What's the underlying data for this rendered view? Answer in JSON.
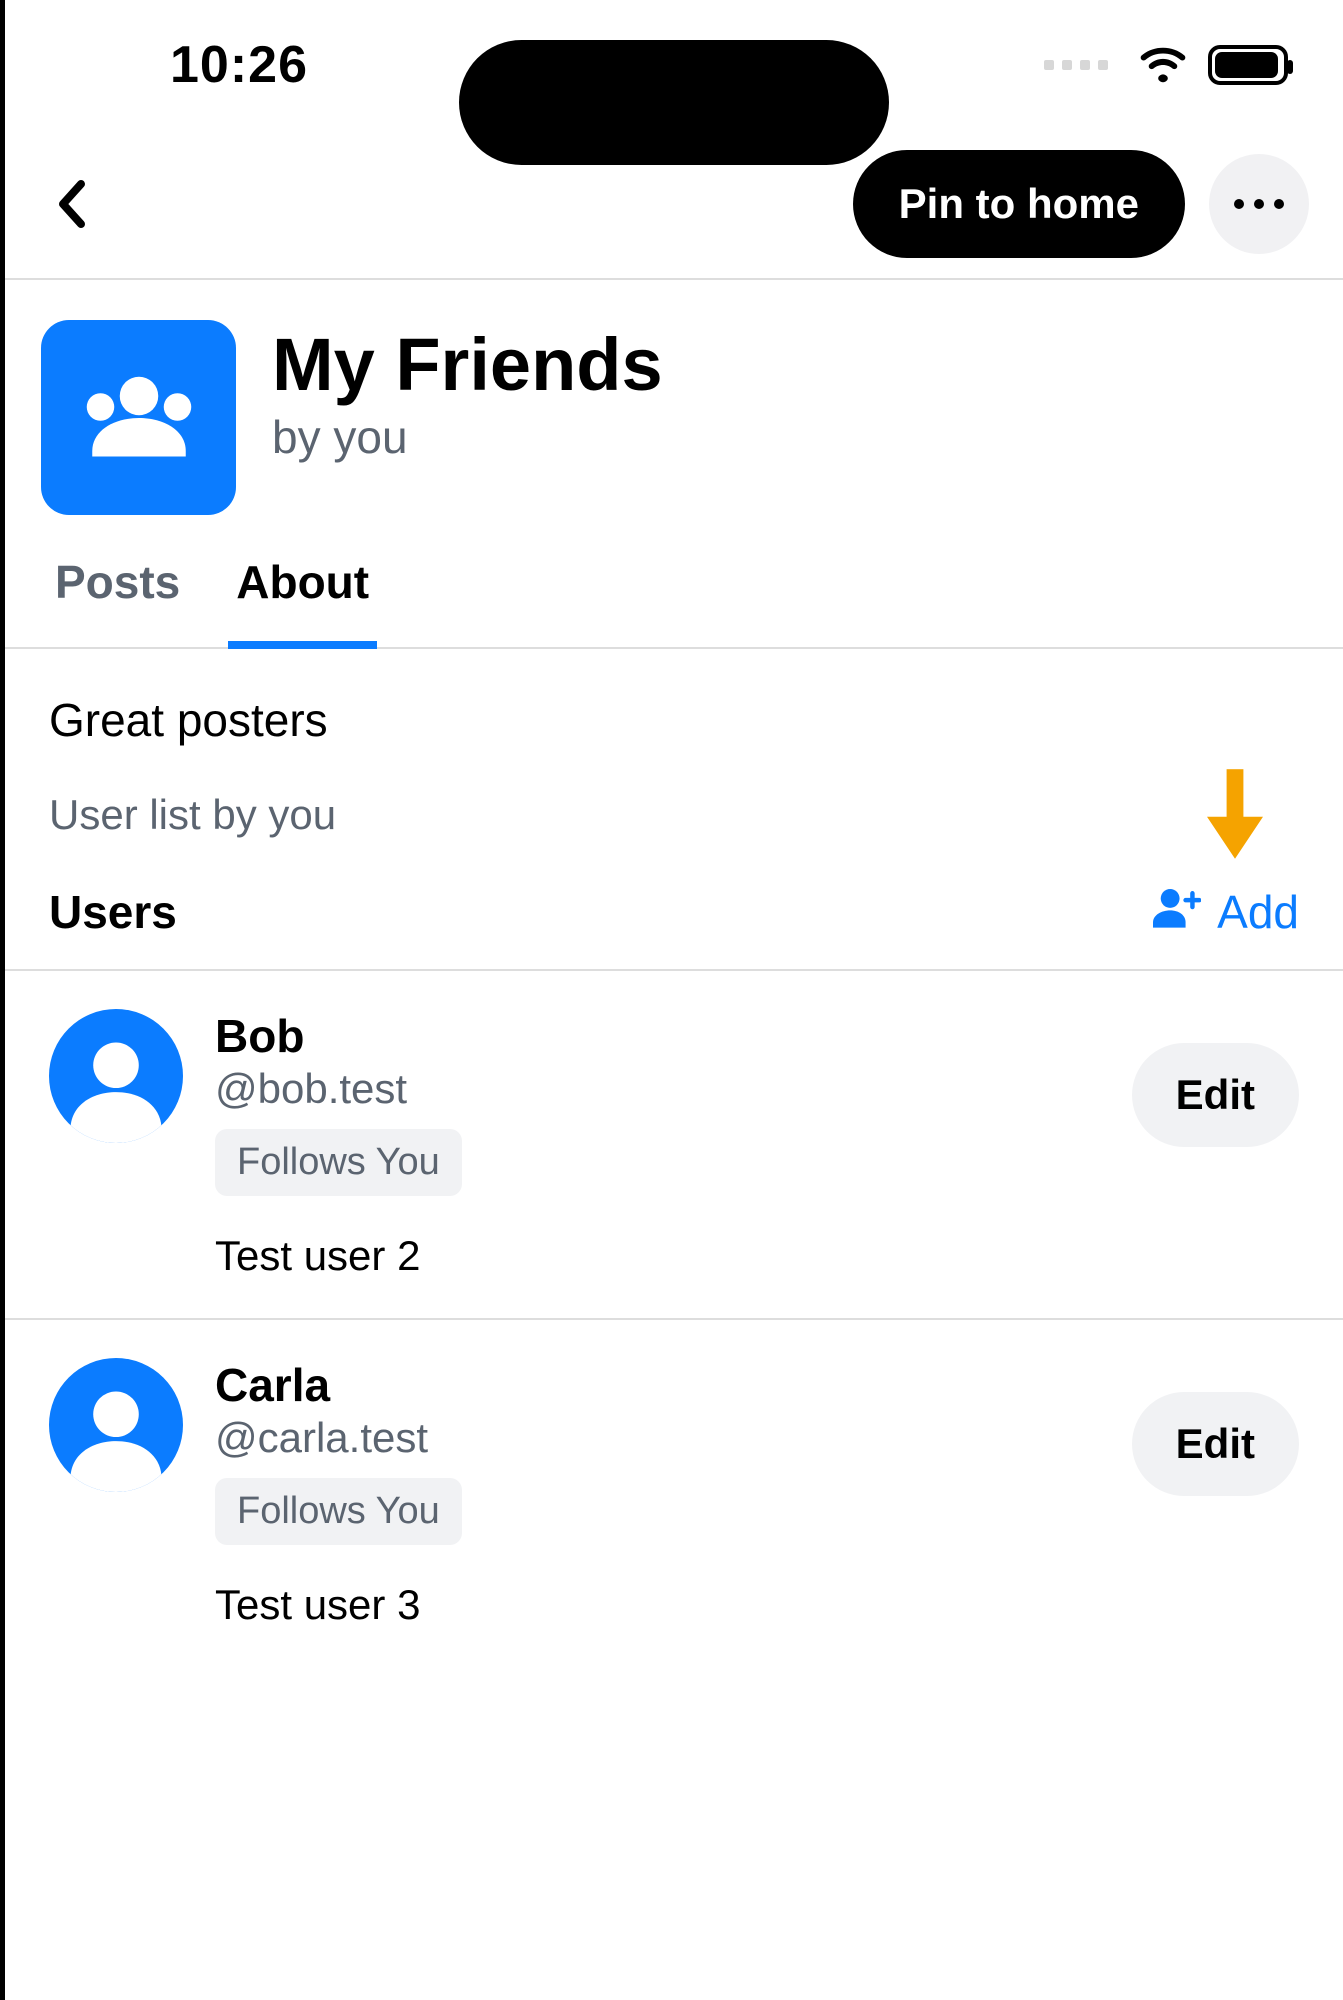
{
  "statusbar": {
    "time": "10:26"
  },
  "nav": {
    "pin_label": "Pin to home"
  },
  "list": {
    "title": "My Friends",
    "byline": "by you"
  },
  "tabs": [
    {
      "label": "Posts",
      "active": false
    },
    {
      "label": "About",
      "active": true
    }
  ],
  "about": {
    "description": "Great posters",
    "byline": "User list by you",
    "users_label": "Users",
    "add_label": "Add"
  },
  "users": [
    {
      "name": "Bob",
      "handle": "@bob.test",
      "badge": "Follows You",
      "bio": "Test user 2",
      "edit_label": "Edit"
    },
    {
      "name": "Carla",
      "handle": "@carla.test",
      "badge": "Follows You",
      "bio": "Test user 3",
      "edit_label": "Edit"
    }
  ]
}
